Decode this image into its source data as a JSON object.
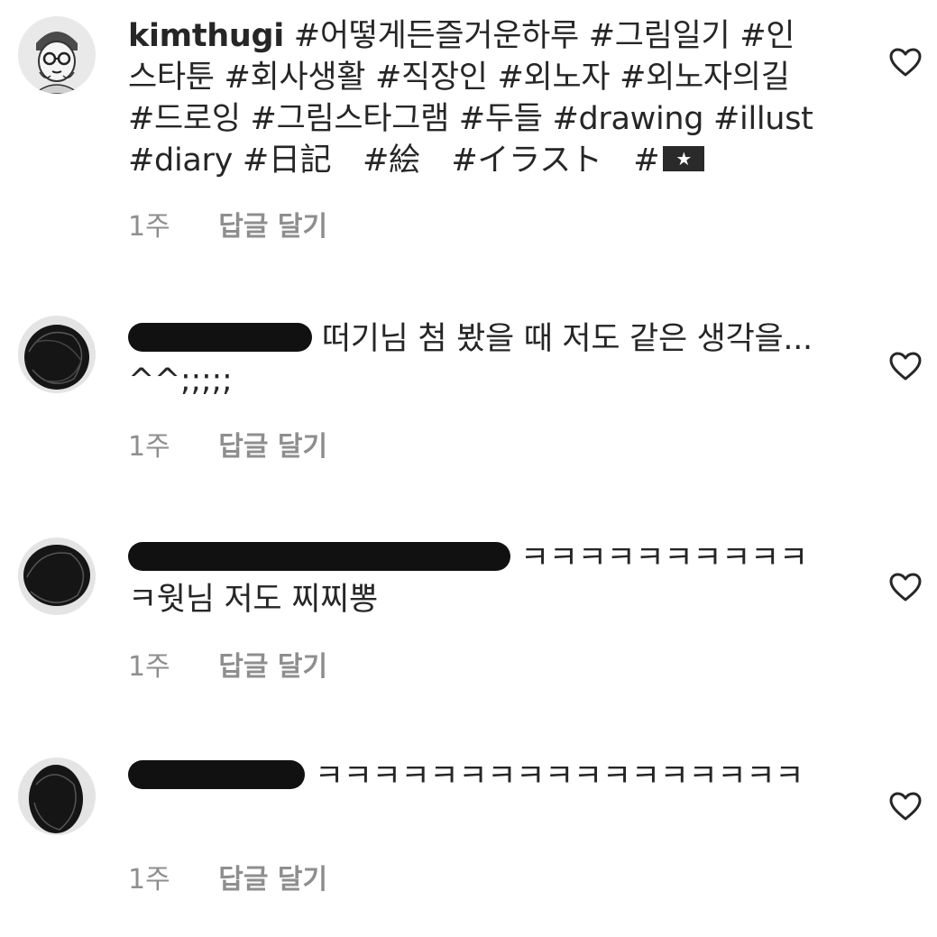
{
  "comments": [
    {
      "username": "kimthugi",
      "text": "#어떻게든즐거운하루 #그림일기 #인스타툰 #회사생활 #직장인 #외노자 #외노자의길 #드로잉 #그림스타그램 #두들 #drawing #illust #diary #日記　#絵　#イラスト　#",
      "emoji_icon": "flag-emoji-icon",
      "time": "1주",
      "reply_label": "답글 달기"
    },
    {
      "username_redacted": true,
      "text": "떠기님 첨 봤을 때 저도 같은 생각을... ^^;;;;;",
      "time": "1주",
      "reply_label": "답글 달기"
    },
    {
      "username_redacted": true,
      "text": "ㅋㅋㅋㅋㅋㅋㅋㅋㅋㅋㅋ웟님 저도 찌찌뽕",
      "time": "1주",
      "reply_label": "답글 달기"
    },
    {
      "username_redacted": true,
      "text": "ㅋㅋㅋㅋㅋㅋㅋㅋㅋㅋㅋㅋㅋㅋㅋㅋㅋ",
      "time": "1주",
      "reply_label": "답글 달기"
    }
  ],
  "icons": {
    "like": "heart-outline-icon",
    "avatar_primary": "cartoon-avatar-icon",
    "avatar_redacted": "scribbled-avatar-icon"
  },
  "colors": {
    "text": "#262626",
    "meta": "#8e8e8e",
    "background": "#ffffff"
  }
}
